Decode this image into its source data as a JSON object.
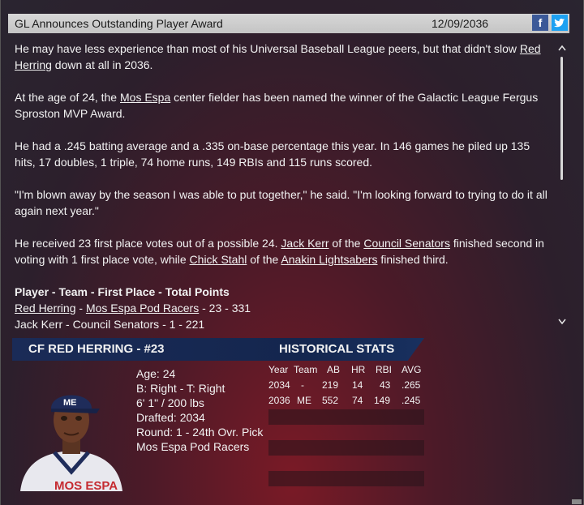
{
  "header": {
    "title": "GL Announces Outstanding Player Award",
    "date": "12/09/2036",
    "facebook_label": "f",
    "twitter_label": "t"
  },
  "article": {
    "p1_pre": "He may have less experience than most of his Universal Baseball League peers, but that didn't slow ",
    "p1_link": "Red Herring",
    "p1_post": " down at all in 2036.",
    "p2_pre": "At the age of 24, the ",
    "p2_link": "Mos Espa",
    "p2_post": " center fielder has been named the winner of the Galactic League Fergus Sproston MVP Award.",
    "p3": "He had a .245 batting average and a .335 on-base percentage this year. In 146 games he piled up 135 hits, 17 doubles, 1 triple, 74 home runs, 149 RBIs and 115 runs scored.",
    "p4": "\"I'm blown away by the season I was able to put together,\" he said. \"I'm looking forward to trying to do it all again next year.\"",
    "p5_a": "He received 23 first place votes out of a possible 24. ",
    "p5_link1": "Jack Kerr",
    "p5_b": " of the ",
    "p5_link2": "Council Senators",
    "p5_c": " finished second in voting with 1 first place vote, while ",
    "p5_link3": "Chick Stahl",
    "p5_d": " of the ",
    "p5_link4": "Anakin Lightsabers",
    "p5_e": " finished third.",
    "table_header": "Player - Team - First Place - Total Points",
    "row1_link1": "Red Herring",
    "row1_sep": " - ",
    "row1_link2": "Mos Espa Pod Racers",
    "row1_rest": " - 23 - 331",
    "row2": "Jack Kerr - Council Senators - 1 - 221"
  },
  "scroll": {
    "up": "^",
    "down": "v"
  },
  "player": {
    "banner": "CF RED HERRING - #23",
    "age": "Age: 24",
    "bats_throws": "B: Right - T: Right",
    "height_weight": "6' 1\" / 200 lbs",
    "drafted": "Drafted: 2034",
    "round": "Round: 1 - 24th Ovr. Pick",
    "team": "Mos Espa Pod Racers"
  },
  "stats": {
    "title": "HISTORICAL STATS",
    "headers": {
      "year": "Year",
      "team": "Team",
      "ab": "AB",
      "hr": "HR",
      "rbi": "RBI",
      "avg": "AVG"
    },
    "rows": [
      {
        "year": "2034",
        "team": "-",
        "ab": "219",
        "hr": "14",
        "rbi": "43",
        "avg": ".265"
      },
      {
        "year": "2036",
        "team": "ME",
        "ab": "552",
        "hr": "74",
        "rbi": "149",
        "avg": ".245"
      }
    ]
  },
  "colors": {
    "banner": "#1a2b57",
    "background": "#4c1a28",
    "titlebar": "#cfcfcf",
    "facebook": "#3b5998",
    "twitter": "#1da1f2"
  }
}
